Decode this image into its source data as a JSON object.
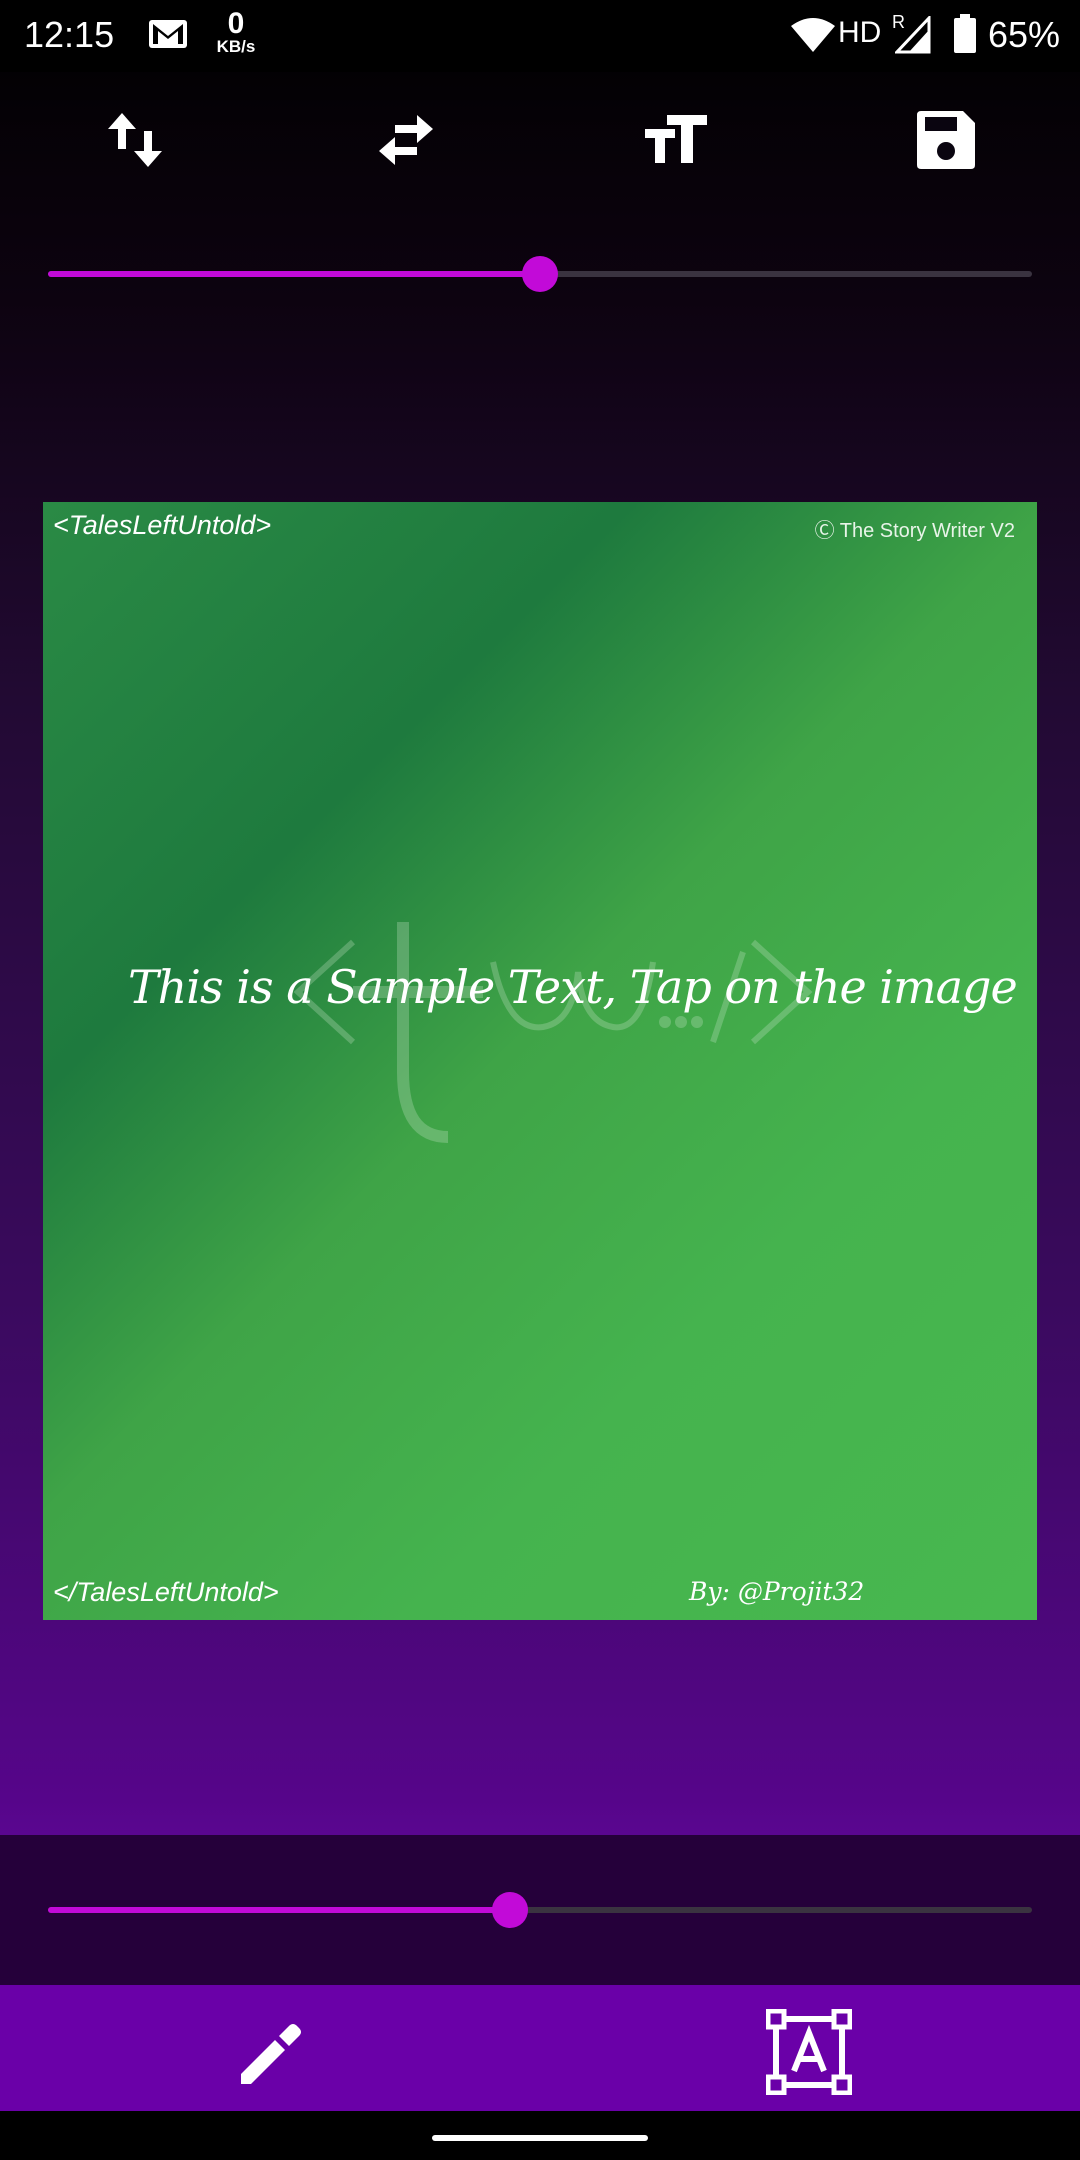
{
  "status_bar": {
    "time": "12:15",
    "net_speed_value": "0",
    "net_speed_unit": "KB/s",
    "network_type": "HD",
    "roaming": "R",
    "battery": "65%",
    "icons": [
      "gmail-icon",
      "wifi-icon",
      "signal-icon",
      "battery-icon"
    ]
  },
  "toolbar": {
    "icons": [
      "swap-vertical-icon",
      "swap-horizontal-icon",
      "text-size-icon",
      "save-icon"
    ]
  },
  "top_slider": {
    "value": 0.5
  },
  "bottom_slider": {
    "value": 0.47
  },
  "card": {
    "top_left": "<TalesLeftUntold>",
    "top_right": "Ⓒ The Story Writer V2",
    "bottom_left": "</TalesLeftUntold>",
    "bottom_right": "By: @Projit32",
    "sample_text": "This is a Sample Text, Tap on the image",
    "gradient_colors": [
      "#1e7a3e",
      "#48b84f"
    ]
  },
  "bottom_bar": {
    "icons": [
      "edit-pencil-icon",
      "text-box-icon"
    ],
    "background": "#6a00a8"
  },
  "accent_color": "#c20ad8"
}
